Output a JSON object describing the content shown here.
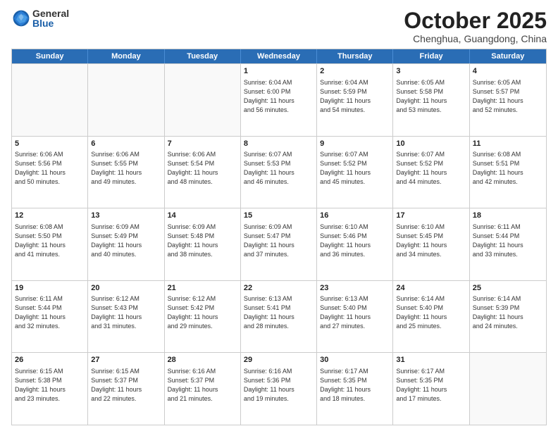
{
  "header": {
    "logo": {
      "general": "General",
      "blue": "Blue"
    },
    "title": "October 2025",
    "location": "Chenghua, Guangdong, China"
  },
  "days_of_week": [
    "Sunday",
    "Monday",
    "Tuesday",
    "Wednesday",
    "Thursday",
    "Friday",
    "Saturday"
  ],
  "weeks": [
    [
      {
        "day": "",
        "info": ""
      },
      {
        "day": "",
        "info": ""
      },
      {
        "day": "",
        "info": ""
      },
      {
        "day": "1",
        "info": "Sunrise: 6:04 AM\nSunset: 6:00 PM\nDaylight: 11 hours\nand 56 minutes."
      },
      {
        "day": "2",
        "info": "Sunrise: 6:04 AM\nSunset: 5:59 PM\nDaylight: 11 hours\nand 54 minutes."
      },
      {
        "day": "3",
        "info": "Sunrise: 6:05 AM\nSunset: 5:58 PM\nDaylight: 11 hours\nand 53 minutes."
      },
      {
        "day": "4",
        "info": "Sunrise: 6:05 AM\nSunset: 5:57 PM\nDaylight: 11 hours\nand 52 minutes."
      }
    ],
    [
      {
        "day": "5",
        "info": "Sunrise: 6:06 AM\nSunset: 5:56 PM\nDaylight: 11 hours\nand 50 minutes."
      },
      {
        "day": "6",
        "info": "Sunrise: 6:06 AM\nSunset: 5:55 PM\nDaylight: 11 hours\nand 49 minutes."
      },
      {
        "day": "7",
        "info": "Sunrise: 6:06 AM\nSunset: 5:54 PM\nDaylight: 11 hours\nand 48 minutes."
      },
      {
        "day": "8",
        "info": "Sunrise: 6:07 AM\nSunset: 5:53 PM\nDaylight: 11 hours\nand 46 minutes."
      },
      {
        "day": "9",
        "info": "Sunrise: 6:07 AM\nSunset: 5:52 PM\nDaylight: 11 hours\nand 45 minutes."
      },
      {
        "day": "10",
        "info": "Sunrise: 6:07 AM\nSunset: 5:52 PM\nDaylight: 11 hours\nand 44 minutes."
      },
      {
        "day": "11",
        "info": "Sunrise: 6:08 AM\nSunset: 5:51 PM\nDaylight: 11 hours\nand 42 minutes."
      }
    ],
    [
      {
        "day": "12",
        "info": "Sunrise: 6:08 AM\nSunset: 5:50 PM\nDaylight: 11 hours\nand 41 minutes."
      },
      {
        "day": "13",
        "info": "Sunrise: 6:09 AM\nSunset: 5:49 PM\nDaylight: 11 hours\nand 40 minutes."
      },
      {
        "day": "14",
        "info": "Sunrise: 6:09 AM\nSunset: 5:48 PM\nDaylight: 11 hours\nand 38 minutes."
      },
      {
        "day": "15",
        "info": "Sunrise: 6:09 AM\nSunset: 5:47 PM\nDaylight: 11 hours\nand 37 minutes."
      },
      {
        "day": "16",
        "info": "Sunrise: 6:10 AM\nSunset: 5:46 PM\nDaylight: 11 hours\nand 36 minutes."
      },
      {
        "day": "17",
        "info": "Sunrise: 6:10 AM\nSunset: 5:45 PM\nDaylight: 11 hours\nand 34 minutes."
      },
      {
        "day": "18",
        "info": "Sunrise: 6:11 AM\nSunset: 5:44 PM\nDaylight: 11 hours\nand 33 minutes."
      }
    ],
    [
      {
        "day": "19",
        "info": "Sunrise: 6:11 AM\nSunset: 5:44 PM\nDaylight: 11 hours\nand 32 minutes."
      },
      {
        "day": "20",
        "info": "Sunrise: 6:12 AM\nSunset: 5:43 PM\nDaylight: 11 hours\nand 31 minutes."
      },
      {
        "day": "21",
        "info": "Sunrise: 6:12 AM\nSunset: 5:42 PM\nDaylight: 11 hours\nand 29 minutes."
      },
      {
        "day": "22",
        "info": "Sunrise: 6:13 AM\nSunset: 5:41 PM\nDaylight: 11 hours\nand 28 minutes."
      },
      {
        "day": "23",
        "info": "Sunrise: 6:13 AM\nSunset: 5:40 PM\nDaylight: 11 hours\nand 27 minutes."
      },
      {
        "day": "24",
        "info": "Sunrise: 6:14 AM\nSunset: 5:40 PM\nDaylight: 11 hours\nand 25 minutes."
      },
      {
        "day": "25",
        "info": "Sunrise: 6:14 AM\nSunset: 5:39 PM\nDaylight: 11 hours\nand 24 minutes."
      }
    ],
    [
      {
        "day": "26",
        "info": "Sunrise: 6:15 AM\nSunset: 5:38 PM\nDaylight: 11 hours\nand 23 minutes."
      },
      {
        "day": "27",
        "info": "Sunrise: 6:15 AM\nSunset: 5:37 PM\nDaylight: 11 hours\nand 22 minutes."
      },
      {
        "day": "28",
        "info": "Sunrise: 6:16 AM\nSunset: 5:37 PM\nDaylight: 11 hours\nand 21 minutes."
      },
      {
        "day": "29",
        "info": "Sunrise: 6:16 AM\nSunset: 5:36 PM\nDaylight: 11 hours\nand 19 minutes."
      },
      {
        "day": "30",
        "info": "Sunrise: 6:17 AM\nSunset: 5:35 PM\nDaylight: 11 hours\nand 18 minutes."
      },
      {
        "day": "31",
        "info": "Sunrise: 6:17 AM\nSunset: 5:35 PM\nDaylight: 11 hours\nand 17 minutes."
      },
      {
        "day": "",
        "info": ""
      }
    ]
  ]
}
